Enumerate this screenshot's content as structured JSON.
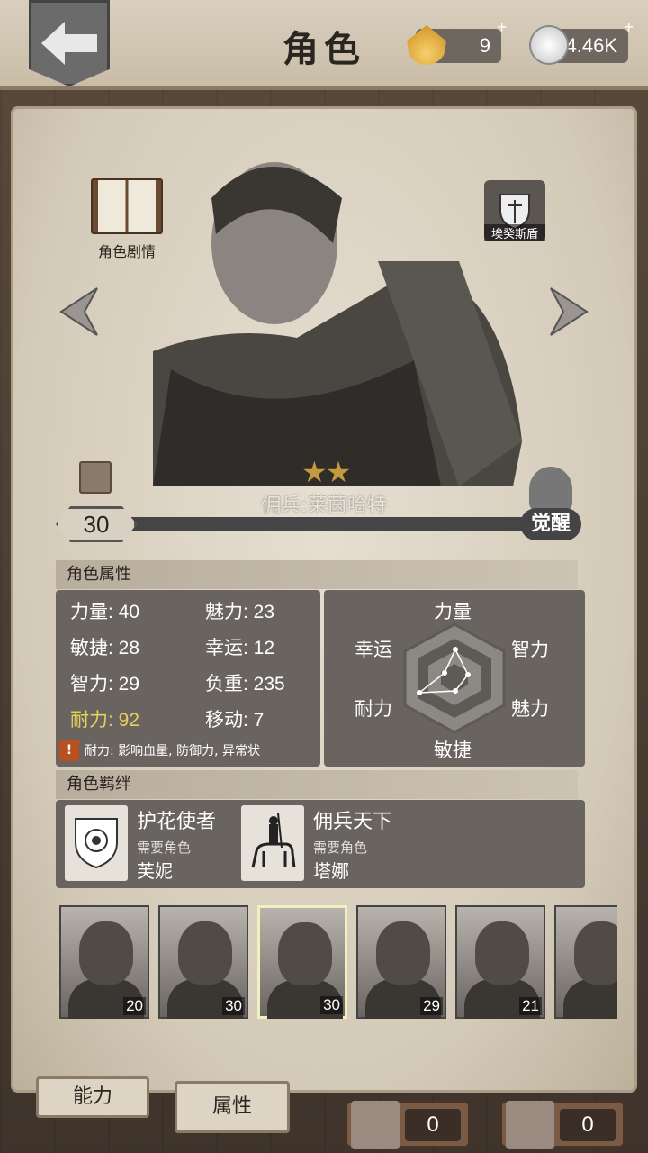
{
  "header": {
    "title": "角色",
    "shells": "9",
    "coins": "4.46K",
    "plus": "+"
  },
  "character": {
    "story_label": "角色剧情",
    "equipment_label": "埃癸斯盾",
    "name": "佣兵:莱茵哈特",
    "stars": 2,
    "level": "30",
    "awaken_label": "觉醒"
  },
  "attributes": {
    "section_title": "角色属性",
    "items": [
      {
        "label": "力量: 40",
        "highlight": false
      },
      {
        "label": "魅力: 23",
        "highlight": false
      },
      {
        "label": "敏捷: 28",
        "highlight": false
      },
      {
        "label": "幸运: 12",
        "highlight": false
      },
      {
        "label": "智力: 29",
        "highlight": false
      },
      {
        "label": "负重: 235",
        "highlight": false
      },
      {
        "label": "耐力: 92",
        "highlight": true
      },
      {
        "label": "移动: 7",
        "highlight": false
      }
    ],
    "note": "耐力: 影响血量, 防御力, 异常状",
    "radar": {
      "top": "力量",
      "top_left": "幸运",
      "top_right": "智力",
      "bottom_left": "耐力",
      "bottom_right": "魅力",
      "bottom": "敏捷"
    }
  },
  "bonds": {
    "section_title": "角色羁绊",
    "items": [
      {
        "title": "护花使者",
        "subtitle": "需要角色",
        "name": "芙妮",
        "icon": "rose-shield-icon"
      },
      {
        "title": "佣兵天下",
        "subtitle": "需要角色",
        "name": "塔娜",
        "icon": "knight-horse-icon"
      }
    ]
  },
  "roster": [
    {
      "level": "20",
      "selected": false
    },
    {
      "level": "30",
      "selected": false
    },
    {
      "level": "30",
      "selected": true
    },
    {
      "level": "29",
      "selected": false
    },
    {
      "level": "21",
      "selected": false
    },
    {
      "level": "",
      "selected": false
    }
  ],
  "tabs": {
    "ability": "能力",
    "attributes": "属性"
  },
  "counters": {
    "puzzle": "0",
    "fragment": "0"
  },
  "colors": {
    "highlight": "#e3d15c",
    "panel": "#6a6460",
    "star": "#c39a3e"
  }
}
